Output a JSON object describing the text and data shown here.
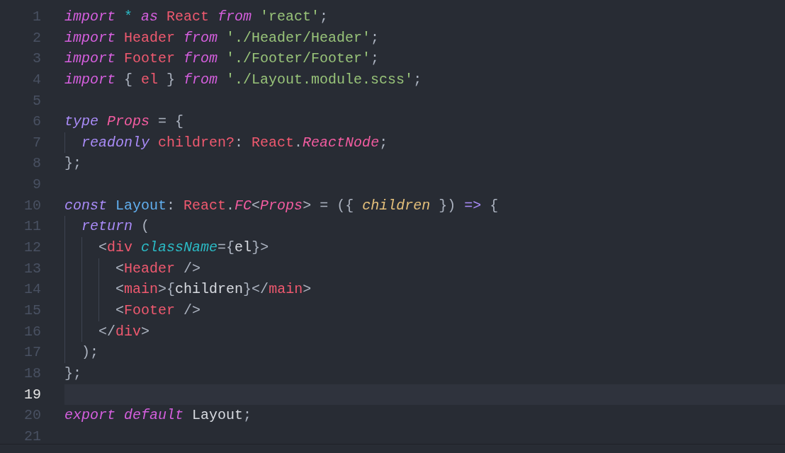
{
  "editor": {
    "lines": [
      {
        "number": "1",
        "selected": false,
        "tokens": [
          {
            "text": "import",
            "kind": "keyword"
          },
          {
            "text": " * ",
            "kind": "operator"
          },
          {
            "text": "as",
            "kind": "keyword"
          },
          {
            "text": " React ",
            "kind": "variable"
          },
          {
            "text": "from",
            "kind": "keyword"
          },
          {
            "text": " 'react'",
            "kind": "string"
          },
          {
            "text": ";",
            "kind": "punctuation"
          }
        ]
      },
      {
        "number": "2",
        "selected": false,
        "tokens": [
          {
            "text": "import",
            "kind": "keyword"
          },
          {
            "text": " Header ",
            "kind": "variable"
          },
          {
            "text": "from",
            "kind": "keyword"
          },
          {
            "text": " './Header/Header'",
            "kind": "string"
          },
          {
            "text": ";",
            "kind": "punctuation"
          }
        ]
      },
      {
        "number": "3",
        "selected": false,
        "tokens": [
          {
            "text": "import",
            "kind": "keyword"
          },
          {
            "text": " Footer ",
            "kind": "variable"
          },
          {
            "text": "from",
            "kind": "keyword"
          },
          {
            "text": " './Footer/Footer'",
            "kind": "string"
          },
          {
            "text": ";",
            "kind": "punctuation"
          }
        ]
      },
      {
        "number": "4",
        "selected": false,
        "tokens": [
          {
            "text": "import",
            "kind": "keyword"
          },
          {
            "text": " { ",
            "kind": "punctuation"
          },
          {
            "text": "el",
            "kind": "variable"
          },
          {
            "text": " } ",
            "kind": "punctuation"
          },
          {
            "text": "from",
            "kind": "keyword"
          },
          {
            "text": " './Layout.module.scss'",
            "kind": "string"
          },
          {
            "text": ";",
            "kind": "punctuation"
          }
        ]
      },
      {
        "number": "5",
        "selected": false
      },
      {
        "number": "6",
        "selected": false,
        "tokens": [
          {
            "text": "type",
            "kind": "storage"
          },
          {
            "text": " Props",
            "kind": "type"
          },
          {
            "text": " = {",
            "kind": "punctuation"
          }
        ]
      },
      {
        "number": "7",
        "selected": false,
        "tokens": [
          {
            "text": "  readonly",
            "kind": "storage"
          },
          {
            "text": " children?",
            "kind": "variable"
          },
          {
            "text": ": ",
            "kind": "punctuation"
          },
          {
            "text": "React",
            "kind": "variable"
          },
          {
            "text": ".",
            "kind": "punctuation"
          },
          {
            "text": "ReactNode",
            "kind": "type"
          },
          {
            "text": ";",
            "kind": "punctuation"
          }
        ]
      },
      {
        "number": "8",
        "selected": false,
        "tokens": [
          {
            "text": "};",
            "kind": "punctuation"
          }
        ]
      },
      {
        "number": "9",
        "selected": false
      },
      {
        "number": "10",
        "selected": false,
        "tokens": [
          {
            "text": "const",
            "kind": "storage"
          },
          {
            "text": " Layout",
            "kind": "function"
          },
          {
            "text": ": ",
            "kind": "punctuation"
          },
          {
            "text": "React",
            "kind": "variable"
          },
          {
            "text": ".",
            "kind": "punctuation"
          },
          {
            "text": "FC",
            "kind": "type"
          },
          {
            "text": "<",
            "kind": "punctuation"
          },
          {
            "text": "Props",
            "kind": "type"
          },
          {
            "text": "> = ({ ",
            "kind": "punctuation"
          },
          {
            "text": "children",
            "kind": "parameter"
          },
          {
            "text": " }) ",
            "kind": "punctuation"
          },
          {
            "text": "=>",
            "kind": "storage"
          },
          {
            "text": " {",
            "kind": "punctuation"
          }
        ]
      },
      {
        "number": "11",
        "selected": false,
        "tokens": [
          {
            "text": "  return",
            "kind": "storage"
          },
          {
            "text": " (",
            "kind": "punctuation"
          }
        ]
      },
      {
        "number": "12",
        "selected": false,
        "tokens": [
          {
            "text": "    <",
            "kind": "punctuation"
          },
          {
            "text": "div",
            "kind": "tag"
          },
          {
            "text": " className",
            "kind": "attribute"
          },
          {
            "text": "={",
            "kind": "punctuation"
          },
          {
            "text": "el",
            "kind": "plain"
          },
          {
            "text": "}>",
            "kind": "punctuation"
          }
        ]
      },
      {
        "number": "13",
        "selected": false,
        "tokens": [
          {
            "text": "      <",
            "kind": "punctuation"
          },
          {
            "text": "Header",
            "kind": "tag"
          },
          {
            "text": " />",
            "kind": "punctuation"
          }
        ]
      },
      {
        "number": "14",
        "selected": false,
        "tokens": [
          {
            "text": "      <",
            "kind": "punctuation"
          },
          {
            "text": "main",
            "kind": "tag"
          },
          {
            "text": ">{",
            "kind": "punctuation"
          },
          {
            "text": "children",
            "kind": "plain"
          },
          {
            "text": "}</",
            "kind": "punctuation"
          },
          {
            "text": "main",
            "kind": "tag"
          },
          {
            "text": ">",
            "kind": "punctuation"
          }
        ]
      },
      {
        "number": "15",
        "selected": false,
        "tokens": [
          {
            "text": "      <",
            "kind": "punctuation"
          },
          {
            "text": "Footer",
            "kind": "tag"
          },
          {
            "text": " />",
            "kind": "punctuation"
          }
        ]
      },
      {
        "number": "16",
        "selected": false,
        "tokens": [
          {
            "text": "    </",
            "kind": "punctuation"
          },
          {
            "text": "div",
            "kind": "tag"
          },
          {
            "text": ">",
            "kind": "punctuation"
          }
        ]
      },
      {
        "number": "17",
        "selected": false,
        "tokens": [
          {
            "text": "  );",
            "kind": "punctuation"
          }
        ]
      },
      {
        "number": "18",
        "selected": false,
        "tokens": [
          {
            "text": "};",
            "kind": "punctuation"
          }
        ]
      },
      {
        "number": "19",
        "selected": true
      },
      {
        "number": "20",
        "selected": false,
        "tokens": [
          {
            "text": "export",
            "kind": "keyword"
          },
          {
            "text": " default",
            "kind": "keyword"
          },
          {
            "text": " Layout",
            "kind": "plain"
          },
          {
            "text": ";",
            "kind": "punctuation"
          }
        ]
      },
      {
        "number": "21",
        "selected": false
      }
    ]
  }
}
